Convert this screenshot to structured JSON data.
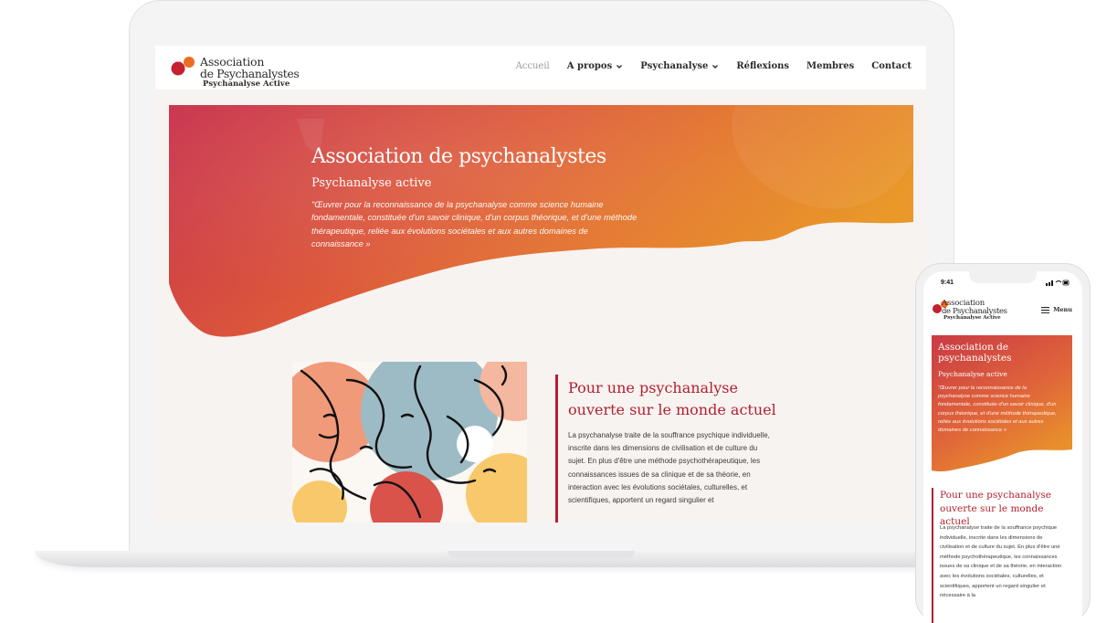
{
  "site": {
    "logo_line1": "Association",
    "logo_line2": "de Psychanalystes",
    "logo_line3": "Psychanalyse Active"
  },
  "nav": {
    "items": [
      {
        "label": "Accueil"
      },
      {
        "label": "A propos"
      },
      {
        "label": "Psychanalyse"
      },
      {
        "label": "Réflexions"
      },
      {
        "label": "Membres"
      },
      {
        "label": "Contact"
      }
    ]
  },
  "hero": {
    "title": "Association de psychanalystes",
    "subtitle": "Psychanalyse active",
    "quote": "\"Œuvrer pour la reconnaissance de la psychanalyse comme science humaine fondamentale, constituée d'un savoir clinique, d'un corpus théorique, et d'une méthode thérapeutique, reliée aux évolutions sociétales et aux autres domaines de connaissance »"
  },
  "content": {
    "title": "Pour une psychanalyse ouverte sur le monde actuel",
    "text": "La psychanalyse traite de la souffrance psychique individuelle, inscrite dans les dimensions de civilisation et de culture du sujet. En plus d'être une méthode psychothérapeutique, les connaissances issues de sa clinique et de sa théorie, en interaction avec les évolutions sociétales, culturelles, et scientifiques, apportent un regard singulier et"
  },
  "mobile": {
    "status_time": "9:41",
    "logo_line1": "Association",
    "logo_line2": "de Psychanalystes",
    "logo_line3": "Psychanalyse Active",
    "menu_label": "Menu",
    "hero_title": "Association de psychanalystes",
    "hero_subtitle": "Psychanalyse active",
    "hero_quote": "\"Œuvrer pour la reconnaissance de la psychanalyse comme science humaine fondamentale, constituée d'un savoir clinique, d'un corpus théorique, et d'une méthode thérapeutique, reliée aux évolutions sociétales et aux autres domaines de connaissance »",
    "content_title": "Pour une psychanalyse ouverte sur le monde actuel",
    "content_text": "La psychanalyse traite de la souffrance psychique individuelle, inscrite dans les dimensions de civilisation et de culture du sujet. En plus d'être une méthode psychothérapeutique, les connaissances issues de sa clinique et de sa théorie, en interaction avec les évolutions sociétales, culturelles, et scientifiques, apportent un regard singulier et nécessaire à la"
  },
  "colors": {
    "accent": "#b22030",
    "hero_gradient_start": "#c8314c",
    "hero_gradient_end": "#e9922a",
    "page_bg": "#f7f3f1"
  }
}
